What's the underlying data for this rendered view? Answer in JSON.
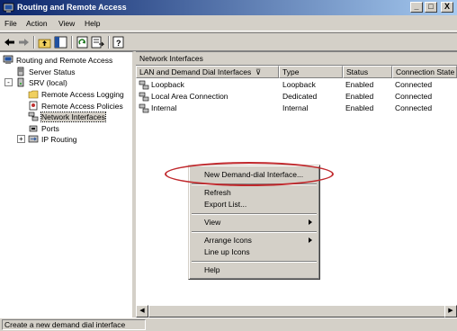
{
  "window": {
    "title": "Routing and Remote Access",
    "controls": {
      "minimize": "_",
      "maximize": "□",
      "close": "X"
    }
  },
  "menu": [
    "File",
    "Action",
    "View",
    "Help"
  ],
  "toolbar": {
    "buttons": [
      "back-arrow-icon",
      "forward-arrow-icon",
      "up-folder-icon",
      "show-hide-tree-icon",
      "refresh-icon",
      "export-list-icon",
      "help-icon"
    ]
  },
  "tree": {
    "root": "Routing and Remote Access",
    "server_status": "Server Status",
    "server": "SRV (local)",
    "children": [
      "Remote Access Logging",
      "Remote Access Policies",
      "Network Interfaces",
      "Ports",
      "IP Routing"
    ],
    "expander_minus": "-",
    "expander_plus": "+"
  },
  "right_pane": {
    "header": "Network Interfaces",
    "columns": [
      "LAN and Demand Dial Interfaces",
      "Type",
      "Status",
      "Connection State"
    ],
    "sort_indicator": "⊽",
    "rows": [
      {
        "name": "Loopback",
        "type": "Loopback",
        "status": "Enabled",
        "state": "Connected"
      },
      {
        "name": "Local Area Connection",
        "type": "Dedicated",
        "status": "Enabled",
        "state": "Connected"
      },
      {
        "name": "Internal",
        "type": "Internal",
        "status": "Enabled",
        "state": "Connected"
      }
    ]
  },
  "context_menu": {
    "items": [
      {
        "label": "New Demand-dial Interface..."
      },
      {
        "label": "Refresh"
      },
      {
        "label": "Export List..."
      },
      {
        "label": "View",
        "submenu": true
      },
      {
        "label": "Arrange Icons",
        "submenu": true
      },
      {
        "label": "Line up Icons"
      },
      {
        "label": "Help"
      }
    ]
  },
  "status_bar": {
    "text": "Create a new demand dial interface"
  },
  "colors": {
    "title_gradient_start": "#0a246a",
    "title_gradient_end": "#a6caf0",
    "face": "#d4d0c8",
    "highlight_ellipse": "#c0282c"
  }
}
